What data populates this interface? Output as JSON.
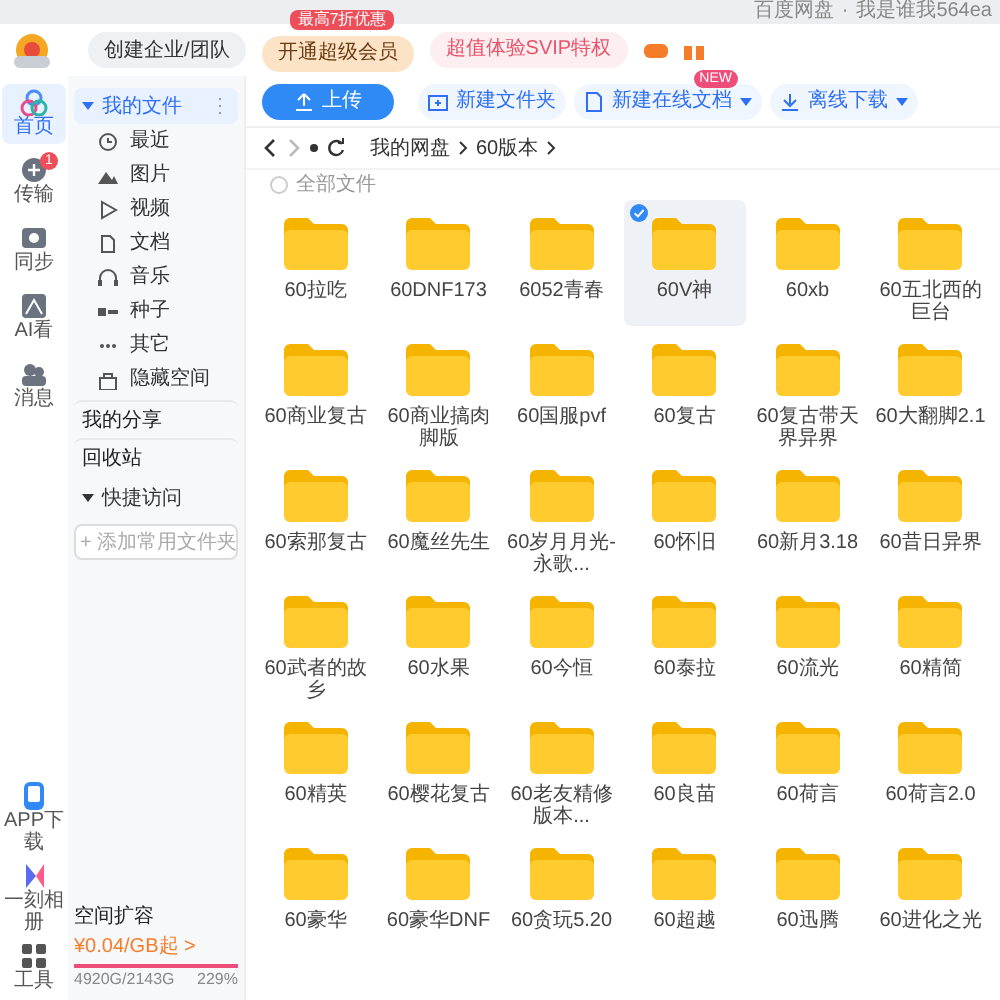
{
  "top_bar": {
    "app": "百度网盘",
    "separator": "·",
    "user": "我是谁我564ea"
  },
  "header": {
    "team_button": "创建企业/团队",
    "vip_button": "开通超级会员",
    "vip_badge": "最高7折优惠",
    "svip_link": "超值体验SVIP特权"
  },
  "rail": [
    {
      "label": "首页",
      "selected": true
    },
    {
      "label": "传输",
      "selected": false,
      "badge": "1"
    },
    {
      "label": "同步",
      "selected": false
    },
    {
      "label": "AI看",
      "selected": false
    },
    {
      "label": "消息",
      "selected": false
    }
  ],
  "rail_bottom": [
    {
      "label": "APP下载"
    },
    {
      "label": "一刻相册"
    },
    {
      "label": "工具"
    }
  ],
  "sidebar": {
    "items": [
      {
        "label": "我的文件",
        "kind": "section",
        "selected": true,
        "more": "⋮"
      },
      {
        "label": "最近",
        "kind": "sub",
        "selected": false
      },
      {
        "label": "图片",
        "kind": "sub",
        "selected": false
      },
      {
        "label": "视频",
        "kind": "sub",
        "selected": false
      },
      {
        "label": "文档",
        "kind": "sub",
        "selected": false
      },
      {
        "label": "音乐",
        "kind": "sub",
        "selected": false
      },
      {
        "label": "种子",
        "kind": "sub",
        "selected": false
      },
      {
        "label": "其它",
        "kind": "sub",
        "selected": false
      },
      {
        "label": "隐藏空间",
        "kind": "sub",
        "selected": false
      },
      {
        "label": "我的分享",
        "kind": "plain",
        "selected": false
      },
      {
        "label": "回收站",
        "kind": "plain",
        "selected": false
      },
      {
        "label": "快捷访问",
        "kind": "section",
        "selected": false
      }
    ],
    "add_folder": "+ 添加常用文件夹",
    "storage": {
      "title": "空间扩容",
      "price": "¥0.04/GB起 >",
      "usage": "4920G/2143G",
      "percent": "229%"
    }
  },
  "toolbar": [
    {
      "label": "上传",
      "kind": "primary"
    },
    {
      "label": "新建文件夹",
      "kind": "folder"
    },
    {
      "label": "新建在线文档",
      "kind": "doc",
      "dropdown": true,
      "badge": "NEW"
    },
    {
      "label": "离线下载",
      "kind": "download",
      "dropdown": true
    }
  ],
  "breadcrumb": [
    "我的网盘",
    "60版本"
  ],
  "select_all": {
    "label": "全部文件",
    "checked": false
  },
  "folders": [
    {
      "name": "60拉吃",
      "selected": false
    },
    {
      "name": "60DNF173",
      "selected": false
    },
    {
      "name": "6052青春",
      "selected": false
    },
    {
      "name": "60V神",
      "selected": true
    },
    {
      "name": "60xb",
      "selected": false
    },
    {
      "name": "60五北西的巨台",
      "selected": false
    },
    {
      "name": "60商业复古",
      "selected": false
    },
    {
      "name": "60商业搞肉脚版",
      "selected": false
    },
    {
      "name": "60国服pvf",
      "selected": false
    },
    {
      "name": "60复古",
      "selected": false
    },
    {
      "name": "60复古带天界异界",
      "selected": false
    },
    {
      "name": "60大翻脚2.1",
      "selected": false
    },
    {
      "name": "60索那复古",
      "selected": false
    },
    {
      "name": "60魔丝先生",
      "selected": false
    },
    {
      "name": "60岁月月光-永歌...",
      "selected": false
    },
    {
      "name": "60怀旧",
      "selected": false
    },
    {
      "name": "60新月3.18",
      "selected": false
    },
    {
      "name": "60昔日异界",
      "selected": false
    },
    {
      "name": "60武者的故乡",
      "selected": false
    },
    {
      "name": "60水果",
      "selected": false
    },
    {
      "name": "60今恒",
      "selected": false
    },
    {
      "name": "60泰拉",
      "selected": false
    },
    {
      "name": "60流光",
      "selected": false
    },
    {
      "name": "60精简",
      "selected": false
    },
    {
      "name": "60精英",
      "selected": false
    },
    {
      "name": "60樱花复古",
      "selected": false
    },
    {
      "name": "60老友精修版本...",
      "selected": false
    },
    {
      "name": "60良苗",
      "selected": false
    },
    {
      "name": "60荷言",
      "selected": false
    },
    {
      "name": "60荷言2.0",
      "selected": false
    },
    {
      "name": "60豪华",
      "selected": false
    },
    {
      "name": "60豪华DNF",
      "selected": false
    },
    {
      "name": "60贪玩5.20",
      "selected": false
    },
    {
      "name": "60超越",
      "selected": false
    },
    {
      "name": "60迅腾",
      "selected": false
    },
    {
      "name": "60进化之光",
      "selected": false
    }
  ]
}
